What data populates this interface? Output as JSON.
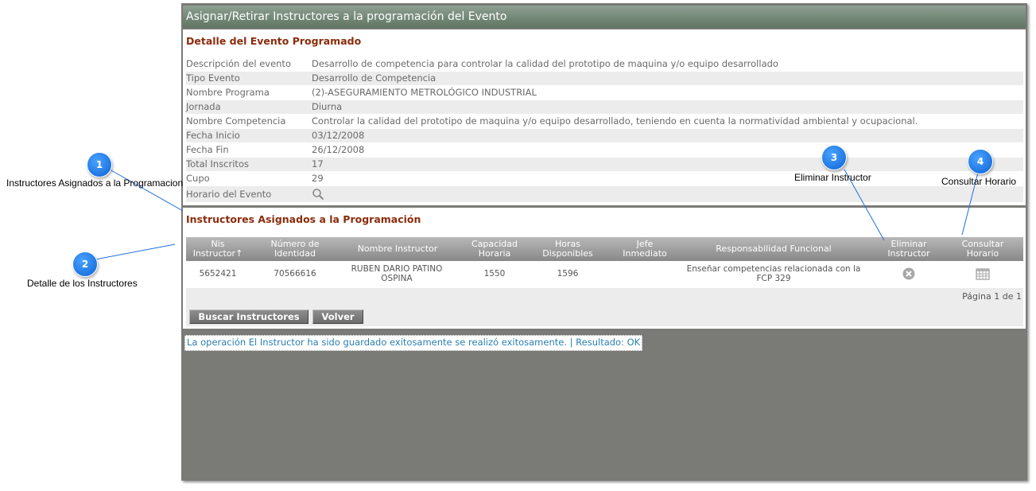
{
  "window": {
    "title": "Asignar/Retirar Instructores a la programación del Evento"
  },
  "event_detail": {
    "section_title": "Detalle del Evento Programado",
    "rows": [
      {
        "label": "Descripción del evento",
        "value": "Desarrollo de competencia para controlar la calidad del prototipo de maquina y/o equipo desarrollado"
      },
      {
        "label": "Tipo Evento",
        "value": "Desarrollo de Competencia"
      },
      {
        "label": "Nombre Programa",
        "value": "(2)-ASEGURAMIENTO METROLÓGICO INDUSTRIAL"
      },
      {
        "label": "Jornada",
        "value": "Diurna"
      },
      {
        "label": "Nombre Competencia",
        "value": "Controlar la calidad del prototipo de maquina y/o equipo desarrollado, teniendo en cuenta la normatividad ambiental y ocupacional."
      },
      {
        "label": "Fecha Inicio",
        "value": "03/12/2008"
      },
      {
        "label": "Fecha Fin",
        "value": "26/12/2008"
      },
      {
        "label": "Total Inscritos",
        "value": "17"
      },
      {
        "label": "Cupo",
        "value": "29"
      },
      {
        "label": "Horario del Evento",
        "icon": "magnifier-icon"
      }
    ]
  },
  "instructors": {
    "section_title": "Instructores Asignados a la Programación",
    "columns": {
      "nis": "Nis Instructor↑",
      "doc": "Número de Identidad",
      "name": "Nombre Instructor",
      "capacity": "Capacidad Horaria",
      "hours": "Horas Disponibles",
      "boss": "Jefe Inmediato",
      "resp": "Responsabilidad Funcional",
      "delete": "Eliminar Instructor",
      "schedule": "Consultar Horario"
    },
    "rows": [
      {
        "nis": "5652421",
        "doc": "70566616",
        "name": "RUBEN DARIO PATINO OSPINA",
        "capacity": "1550",
        "hours": "1596",
        "boss": "",
        "resp": "Enseñar competencias relacionada con la FCP 329",
        "delete_icon": "delete-circle-icon",
        "schedule_icon": "calendar-icon"
      }
    ],
    "pager": "Página 1 de 1",
    "buttons": {
      "search": "Buscar Instructores",
      "back": "Volver"
    }
  },
  "status_message": "La operación El Instructor ha sido guardado exitosamente se realizó exitosamente. | Resultado: OK",
  "callouts": [
    {
      "number": "1",
      "label": "Instructores Asignados a la Programacion"
    },
    {
      "number": "2",
      "label": "Detalle de los Instructores"
    },
    {
      "number": "3",
      "label": "Eliminar Instructor"
    },
    {
      "number": "4",
      "label": "Consultar Horario"
    }
  ],
  "colors": {
    "title_bar": "#5f7563",
    "section_title": "#8b2c0c",
    "callout": "#0b62d6",
    "status_text": "#2a7fb0"
  }
}
